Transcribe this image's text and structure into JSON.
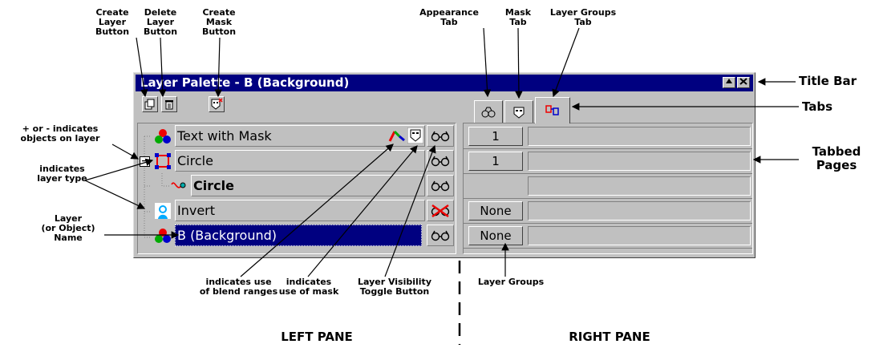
{
  "window": {
    "title": "Layer Palette - B (Background)",
    "title_buttons": [
      "maximize-icon",
      "close-icon"
    ]
  },
  "toolbar": {
    "tools": [
      {
        "name": "create-layer",
        "icon": "new-layer-icon"
      },
      {
        "name": "delete-layer",
        "icon": "trash-icon"
      },
      {
        "name": "create-mask",
        "icon": "mask-icon"
      }
    ]
  },
  "layers": [
    {
      "name": "Text with Mask",
      "type_icon": "raster-layer-icon",
      "has_blend": true,
      "has_mask": true,
      "visibility": "visible",
      "bold": false,
      "selected": false,
      "expand": ""
    },
    {
      "name": "Circle",
      "type_icon": "vector-layer-icon",
      "has_blend": false,
      "has_mask": false,
      "visibility": "visible",
      "bold": false,
      "selected": false,
      "expand": "−"
    },
    {
      "name": "Circle",
      "type_icon": "vector-object-icon",
      "has_blend": false,
      "has_mask": false,
      "visibility": "visible",
      "bold": true,
      "selected": false,
      "expand": ""
    },
    {
      "name": "Invert",
      "type_icon": "adjustment-layer-icon",
      "has_blend": false,
      "has_mask": false,
      "visibility": "hidden",
      "bold": false,
      "selected": false,
      "expand": ""
    },
    {
      "name": "B (Background)",
      "type_icon": "raster-layer-icon",
      "has_blend": false,
      "has_mask": false,
      "visibility": "visible",
      "bold": false,
      "selected": true,
      "expand": ""
    }
  ],
  "tabs": [
    {
      "name": "appearance",
      "icon": "appearance-icon",
      "active": false
    },
    {
      "name": "mask",
      "icon": "mask-icon",
      "active": false
    },
    {
      "name": "layer-groups",
      "icon": "layer-groups-icon",
      "active": true
    }
  ],
  "groups": [
    "1",
    "1",
    "",
    "None",
    "None"
  ],
  "callouts": {
    "create_layer": "Create\nLayer\nButton",
    "delete_layer": "Delete\nLayer\nButton",
    "create_mask": "Create\nMask\nButton",
    "appearance_tab": "Appearance\nTab",
    "mask_tab": "Mask\nTab",
    "layer_groups_tab": "Layer Groups\nTab",
    "title_bar": "Title Bar",
    "tabs": "Tabs",
    "tabbed_pages": "Tabbed\nPages",
    "plus_minus": "+ or - indicates\nobjects on layer",
    "layer_type": "indicates\nlayer type",
    "layer_name": "Layer\n(or Object)\nName",
    "blend": "indicates use\nof blend ranges",
    "mask_use": "indicates\nuse of mask",
    "visibility": "Layer Visibility\nToggle Button",
    "layer_groups": "Layer Groups",
    "left_pane": "LEFT PANE",
    "right_pane": "RIGHT PANE"
  },
  "colors": {
    "titlebar": "#000080",
    "window": "#c0c0c0",
    "selection": "#000080"
  }
}
